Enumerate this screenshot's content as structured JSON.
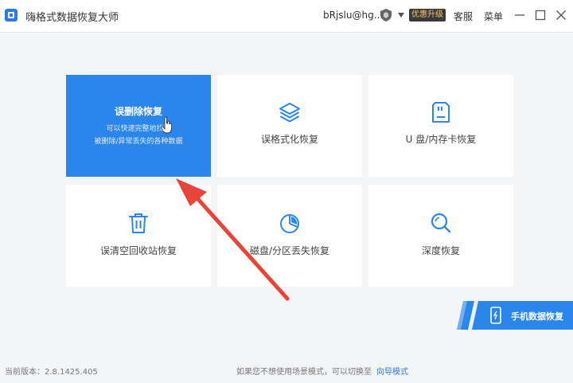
{
  "titlebar": {
    "app_title": "嗨格式数据恢复大师",
    "account": "bRjslu@hg...",
    "vip_label": "优惠升级",
    "service_label": "客服",
    "menu_label": "菜单"
  },
  "cards": {
    "mistaken_delete": {
      "title": "误删除恢复",
      "desc_line1": "可以快速完整地找回",
      "desc_line2": "被删除/异常丢失的各种数据"
    },
    "format": {
      "label": "误格式化恢复"
    },
    "udisk": {
      "label": "U 盘/内存卡恢复"
    },
    "recycle": {
      "label": "误清空回收站恢复"
    },
    "partition": {
      "label": "磁盘/分区丢失恢复"
    },
    "deep": {
      "label": "深度恢复"
    }
  },
  "mobile": {
    "label": "手机数据恢复"
  },
  "footer": {
    "version": "当前版本：2.8.1425.405",
    "hint": "如果您不想使用场景模式，可以切换至",
    "wizard_link": "向导模式"
  },
  "colors": {
    "accent": "#2b86ec",
    "arrow": "#e8443a",
    "background": "#f4f5f7"
  }
}
